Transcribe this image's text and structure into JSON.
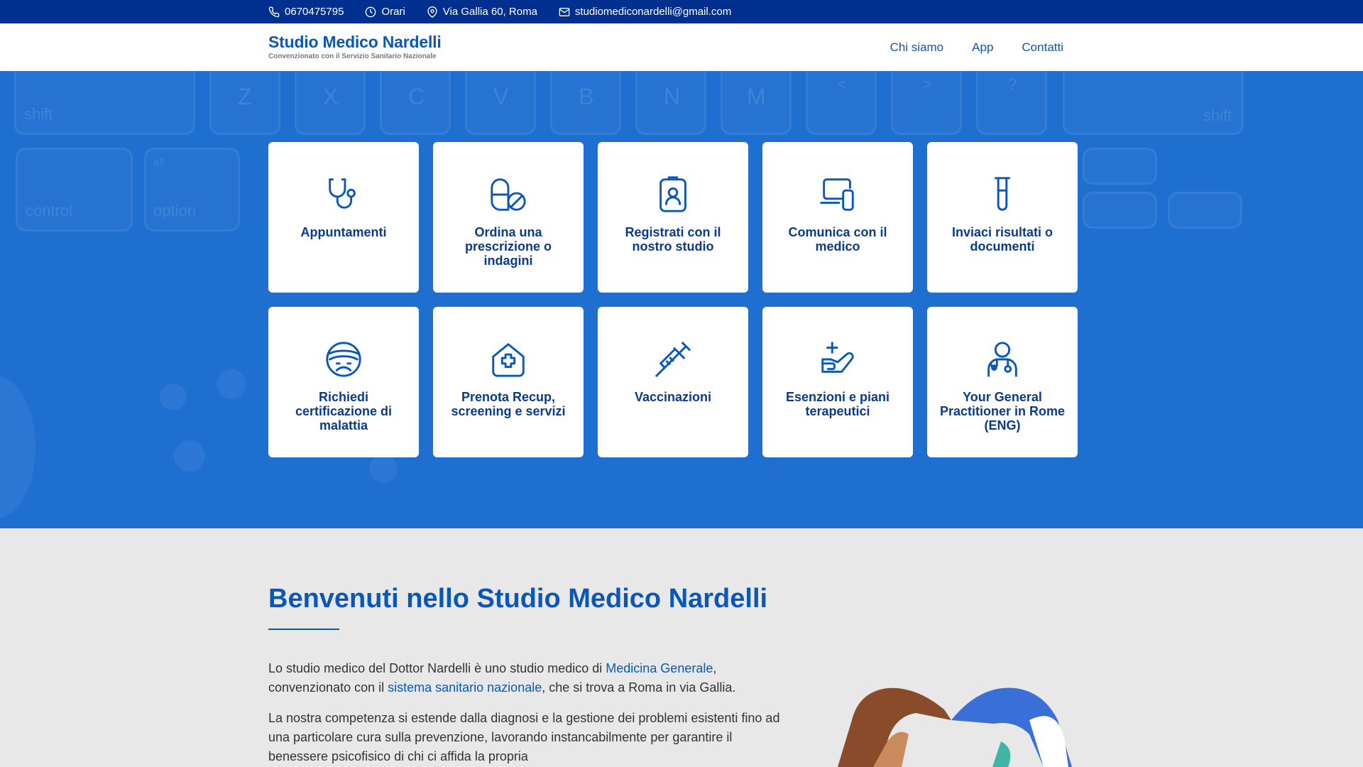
{
  "topbar": {
    "phone": "0670475795",
    "hours": "Orari",
    "address": "Via Gallia 60, Roma",
    "email": "studiomediconardelli@gmail.com"
  },
  "brand": {
    "title": "Studio Medico Nardelli",
    "subtitle": "Convenzionato con il Servizio Sanitario Nazionale"
  },
  "nav": [
    {
      "label": "Chi siamo"
    },
    {
      "label": "App"
    },
    {
      "label": "Contatti"
    }
  ],
  "hero_bg_keys": [
    "shift",
    "Z",
    "X",
    "C",
    "V",
    "B",
    "N",
    "M",
    "<",
    ">",
    "?",
    "shift",
    "control",
    "alt",
    "option"
  ],
  "cards": [
    {
      "label": "Appuntamenti",
      "icon": "stethoscope-icon"
    },
    {
      "label": "Ordina una prescrizione o indagini",
      "icon": "pills-icon"
    },
    {
      "label": "Registrati con il nostro studio",
      "icon": "id-badge-icon"
    },
    {
      "label": "Comunica con il medico",
      "icon": "devices-icon"
    },
    {
      "label": "Inviaci risultati o documenti",
      "icon": "test-tube-icon"
    },
    {
      "label": "Richiedi certificazione di malattia",
      "icon": "sick-face-icon"
    },
    {
      "label": "Prenota Recup, screening e servizi",
      "icon": "medical-house-icon"
    },
    {
      "label": "Vaccinazioni",
      "icon": "syringe-icon"
    },
    {
      "label": "Esenzioni e piani terapeutici",
      "icon": "hand-care-icon"
    },
    {
      "label": "Your General Practitioner in Rome (ENG)",
      "icon": "doctor-icon"
    }
  ],
  "content": {
    "welcome": "Benvenuti nello Studio Medico Nardelli",
    "p1_a": "Lo studio medico del Dottor Nardelli è uno studio medico di ",
    "p1_link1": "Medicina Generale",
    "p1_b": ",",
    "p1_c": "convenzionato con il ",
    "p1_link2": "sistema sanitario nazionale",
    "p1_d": ", che si trova a Roma in via Gallia.",
    "p2": "La nostra competenza si estende dalla diagnosi e la gestione dei problemi esistenti fino ad una particolare cura sulla prevenzione, lavorando instancabilmente per garantire il benessere psicofisico di chi ci affida la propria"
  },
  "colors": {
    "topbar": "#00308f",
    "brand": "#0b57b7",
    "hero": "#1f6fd1",
    "card_text": "#0a3a8a"
  }
}
